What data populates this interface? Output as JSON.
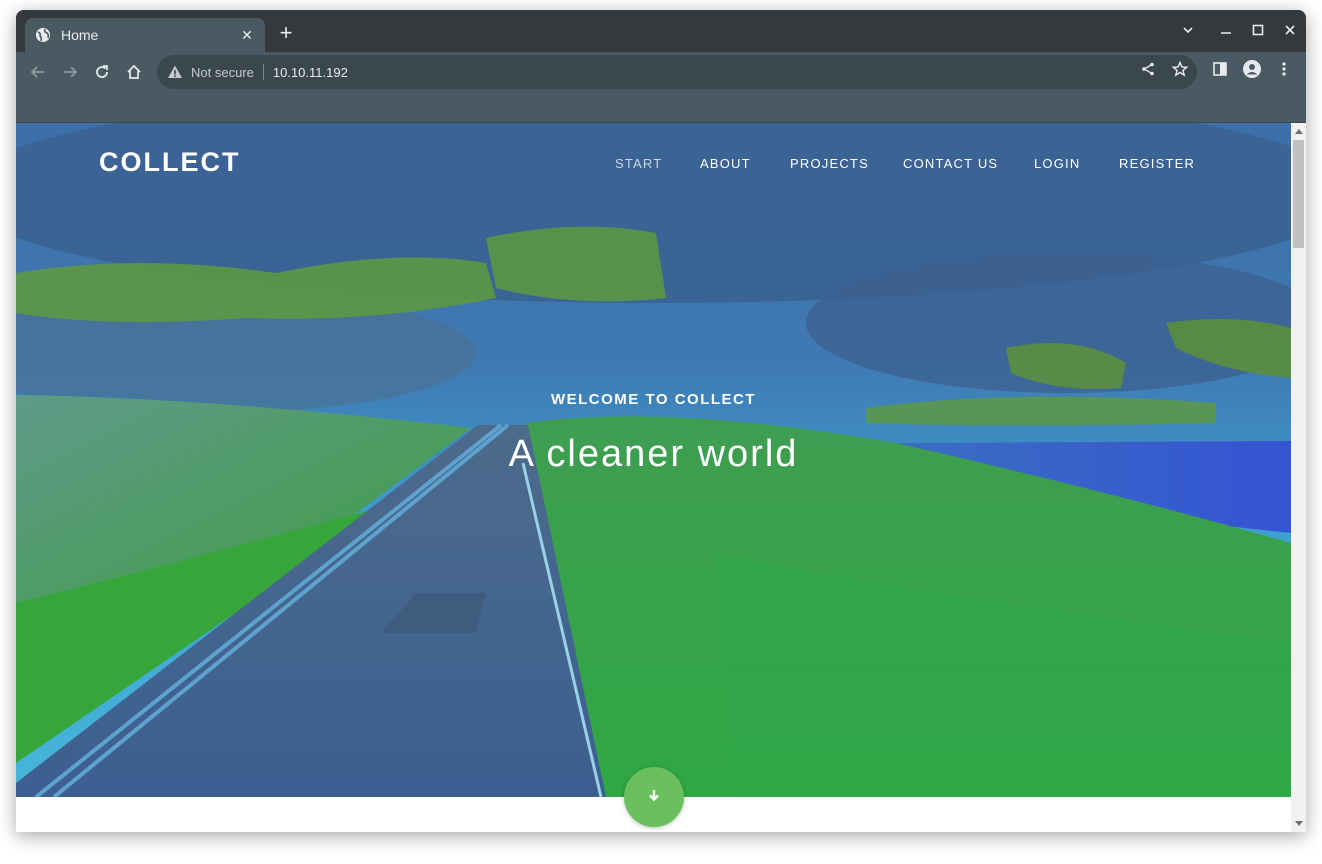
{
  "browser": {
    "tab": {
      "title": "Home",
      "favicon": "globe-icon"
    },
    "address": {
      "security": "Not secure",
      "url": "10.10.11.192"
    },
    "colors": {
      "frame": "#35393d",
      "toolbar": "#495a63",
      "omnibox": "#3a474e"
    }
  },
  "site": {
    "brand": "COLLECT",
    "nav": [
      {
        "label": "START",
        "active": true
      },
      {
        "label": "ABOUT",
        "active": false
      },
      {
        "label": "PROJECTS",
        "active": false
      },
      {
        "label": "CONTACT US",
        "active": false
      },
      {
        "label": "LOGIN",
        "active": false
      },
      {
        "label": "REGISTER",
        "active": false
      }
    ],
    "hero": {
      "kicker": "WELCOME TO COLLECT",
      "headline": "A cleaner world",
      "scroll_button_icon": "arrow-down-icon",
      "accent_color": "#6abf5e"
    }
  }
}
